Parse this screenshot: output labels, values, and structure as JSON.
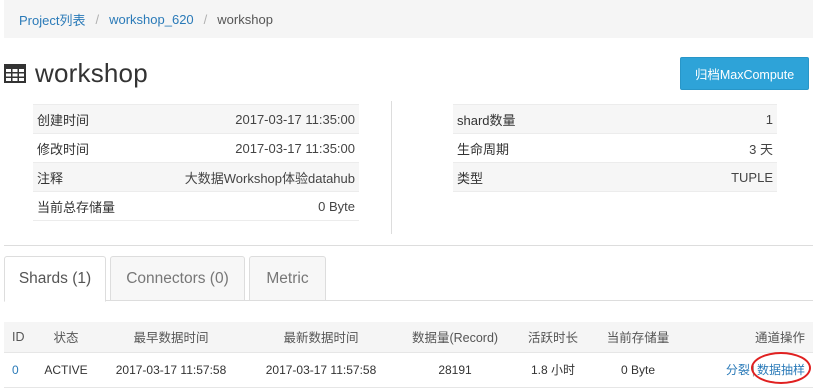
{
  "breadcrumb": {
    "items": [
      "Project列表",
      "workshop_620"
    ],
    "current": "workshop",
    "separator": "/"
  },
  "header": {
    "title": "workshop",
    "icon": "table-icon",
    "archive_button": "归档MaxCompute"
  },
  "info_left": [
    {
      "label": "创建时间",
      "value": "2017-03-17 11:35:00"
    },
    {
      "label": "修改时间",
      "value": "2017-03-17 11:35:00"
    },
    {
      "label": "注释",
      "value": "大数据Workshop体验datahub"
    },
    {
      "label": "当前总存储量",
      "value": "0 Byte"
    }
  ],
  "info_right": [
    {
      "label": "shard数量",
      "value": "1"
    },
    {
      "label": "生命周期",
      "value": "3 天"
    },
    {
      "label": "类型",
      "value": "TUPLE"
    }
  ],
  "tabs": {
    "shards": "Shards (1)",
    "connectors": "Connectors (0)",
    "metric": "Metric"
  },
  "shard_table": {
    "headers": {
      "id": "ID",
      "status": "状态",
      "earliest": "最早数据时间",
      "latest": "最新数据时间",
      "records": "数据量(Record)",
      "active": "活跃时长",
      "storage": "当前存储量",
      "ops": "通道操作"
    },
    "rows": [
      {
        "id": "0",
        "status": "ACTIVE",
        "earliest": "2017-03-17 11:57:58",
        "latest": "2017-03-17 11:57:58",
        "records": "28191",
        "active": "1.8 小时",
        "storage": "0 Byte",
        "op_split": "分裂",
        "op_sep": "|",
        "op_sample": "数据抽样"
      }
    ]
  },
  "colors": {
    "accent": "#2ea3d8",
    "link": "#2a7ab8",
    "highlight_circle": "#e02020"
  }
}
